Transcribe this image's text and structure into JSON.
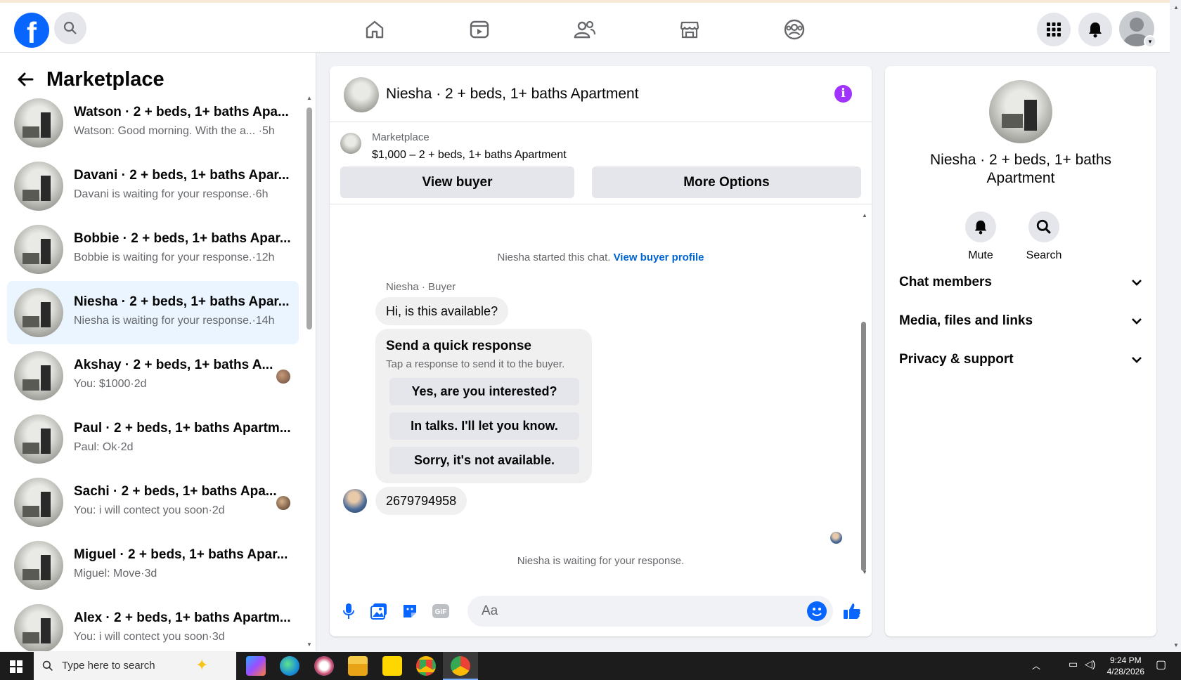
{
  "topbar": {
    "logo_letter": "f",
    "nav": [
      "home-icon",
      "video-icon",
      "friends-icon",
      "marketplace-icon",
      "groups-icon"
    ]
  },
  "sidebar": {
    "title": "Marketplace",
    "conversations": [
      {
        "title": "Watson · 2 + beds, 1+ baths Apa...",
        "sub": "Watson: Good morning. With the a...  ·5h",
        "active": false
      },
      {
        "title": "Davani · 2 + beds, 1+ baths Apar...",
        "sub": "Davani is waiting for your response.·6h",
        "active": false
      },
      {
        "title": "Bobbie · 2 + beds, 1+ baths Apar...",
        "sub": "Bobbie is waiting for your response.·12h",
        "active": false
      },
      {
        "title": "Niesha · 2 + beds, 1+ baths Apar...",
        "sub": "Niesha is waiting for your response.·14h",
        "active": true
      },
      {
        "title": "Akshay · 2 + beds, 1+ baths A...",
        "sub": "You: $1000·2d",
        "active": false
      },
      {
        "title": "Paul · 2 + beds, 1+ baths Apartm...",
        "sub": "Paul: Ok·2d",
        "active": false
      },
      {
        "title": "Sachi · 2 + beds, 1+ baths Apa...",
        "sub": "You: i will contect you soon·2d",
        "active": false
      },
      {
        "title": "Miguel · 2 + beds, 1+ baths Apar...",
        "sub": "Miguel: Move·3d",
        "active": false
      },
      {
        "title": "Alex · 2 + beds, 1+ baths Apartm...",
        "sub": "You: i will contect you soon·3d",
        "active": false
      }
    ]
  },
  "chat": {
    "header_name": "Niesha · 2 + beds, 1+ baths Apartment",
    "marketplace_label": "Marketplace",
    "listing": "$1,000 – 2 + beds, 1+ baths Apartment",
    "view_buyer": "View buyer",
    "more_options": "More Options",
    "started_text": "Niesha started this chat.",
    "view_profile_link": "View buyer profile",
    "sender_label": "Niesha · Buyer",
    "first_message": "Hi, is this available?",
    "quick_title": "Send a quick response",
    "quick_sub": "Tap a response to send it to the buyer.",
    "quick_responses": [
      "Yes, are you interested?",
      "In talks. I'll let you know.",
      "Sorry, it's not available."
    ],
    "phone_message": "2679794958",
    "waiting_text": "Niesha is waiting for your response.",
    "composer_placeholder": "Aa"
  },
  "right_panel": {
    "name": "Niesha · 2 + beds, 1+ baths Apartment",
    "mute": "Mute",
    "search": "Search",
    "sections": [
      "Chat members",
      "Media, files and links",
      "Privacy & support"
    ]
  },
  "taskbar": {
    "search_placeholder": "Type here to search",
    "time": "9:24 PM",
    "date": "4/28/2026"
  },
  "colors": {
    "brand": "#0866ff",
    "info": "#a033ff",
    "link": "#0064d1"
  }
}
